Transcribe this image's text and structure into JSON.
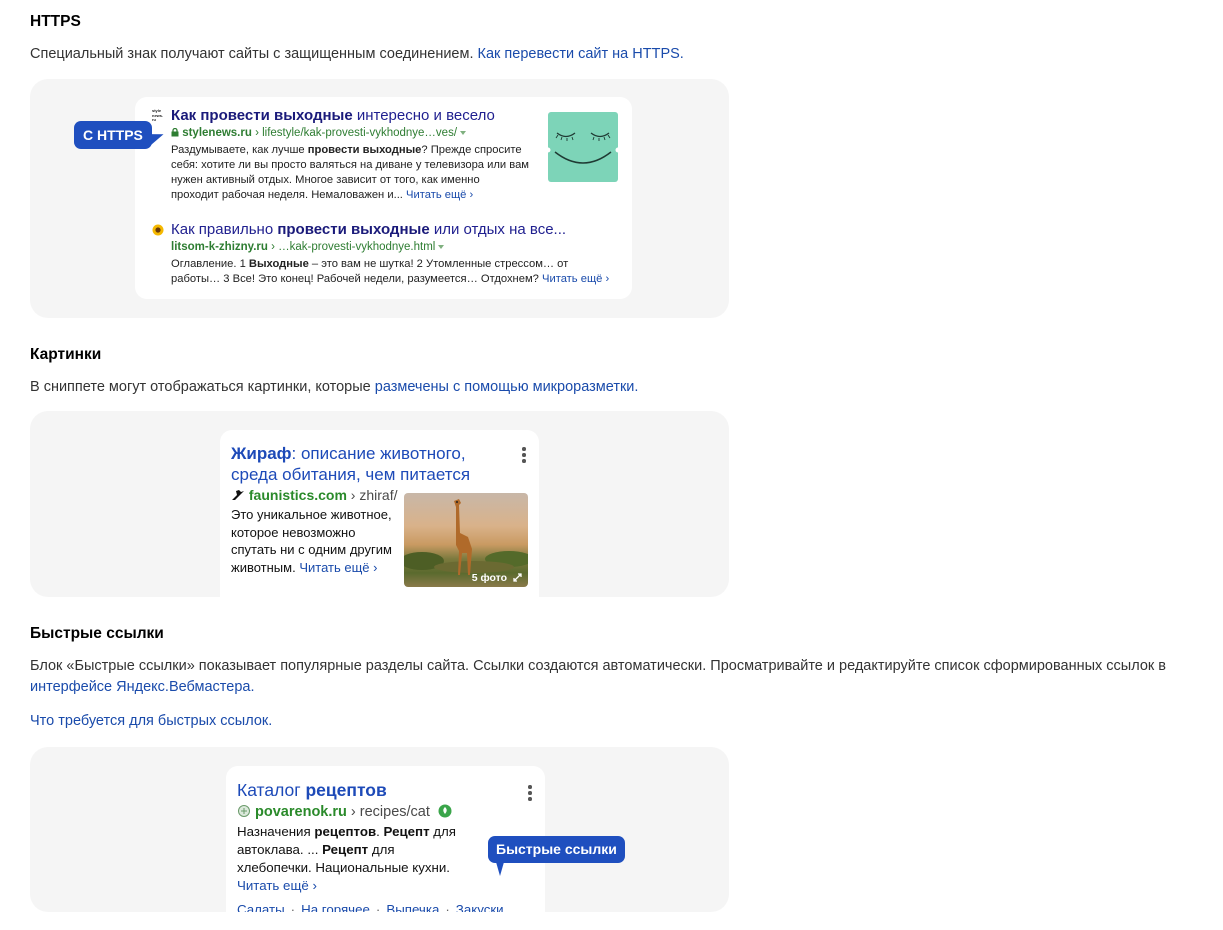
{
  "https": {
    "heading": "HTTPS",
    "desc": "Специальный знак получают сайты с защищенным соединением.",
    "desc_link": "Как перевести сайт на HTTPS.",
    "badge": "С HTTPS",
    "result1": {
      "favicon_text": "style news. ru",
      "title_bold": "Как провести выходные",
      "title_rest": " интересно и весело",
      "domain": "stylenews.ru",
      "path": " › lifestyle/kak-provesti-vykhodnye…ves/",
      "text_pre": "Раздумываете, как лучше ",
      "text_bold": "провести выходные",
      "text_post": "? Прежде спросите себя: хотите ли вы просто валяться на диване у телевизора или вам нужен активный отдых. Многое зависит от того, как именно проходит рабочая неделя. Немаловажен и...",
      "more": "Читать ещё ›",
      "thumb_color": "#7dd4b8"
    },
    "result2": {
      "title_pre": "Как правильно ",
      "title_bold": "провести выходные",
      "title_post": " или отдых на все...",
      "domain": "litsom-k-zhizny.ru",
      "path": " › …kak-provesti-vykhodnye.html",
      "text_pre": "Оглавление. 1 ",
      "text_bold": "Выходные",
      "text_post": " – это вам не шутка! 2 Утомленные стрессом… от работы… 3 Все! Это конец! Рабочей недели, разумеется… Отдохнем?",
      "more": "Читать ещё ›"
    }
  },
  "images": {
    "heading": "Картинки",
    "desc": "В сниппете могут отображаться картинки, которые",
    "desc_link": "размечены с помощью микроразметки.",
    "card": {
      "title_bold": "Жираф",
      "title_rest": ": описание животного, среда обитания, чем питается",
      "domain": "faunistics.com",
      "path": " › zhiraf/",
      "text": "Это уникальное животное, которое невозможно спутать ни с одним другим животным.",
      "more": "Читать ещё ›",
      "photo_count": "5 фото"
    }
  },
  "quick": {
    "heading": "Быстрые ссылки",
    "desc": "Блок «Быстрые ссылки» показывает популярные разделы сайта. Ссылки создаются автоматически. Просматривайте и редактируйте список сформированных ссылок в",
    "desc_link": "интерфейсе Яндекс.Вебмастера.",
    "link2": "Что требуется для быстрых ссылок.",
    "badge": "Быстрые ссылки",
    "card": {
      "title_pre": "Каталог ",
      "title_bold": "рецептов",
      "domain": "povarenok.ru",
      "path": " › recipes/cat",
      "text_pre": "Назначения ",
      "text_b1": "рецептов",
      "text_mid1": ". ",
      "text_b2": "Рецепт",
      "text_mid2": " для автоклава. ... ",
      "text_b3": "Рецепт",
      "text_post": " для хлебопечки. Национальные кухни.",
      "more": "Читать ещё ›",
      "links": [
        "Салаты",
        "На горячее",
        "Выпечка",
        "Закуски"
      ]
    }
  },
  "colors": {
    "link": "#1a4bab",
    "badge": "#1f4fbf",
    "panel": "#f5f5f5",
    "url_green": "#2e7d32"
  }
}
